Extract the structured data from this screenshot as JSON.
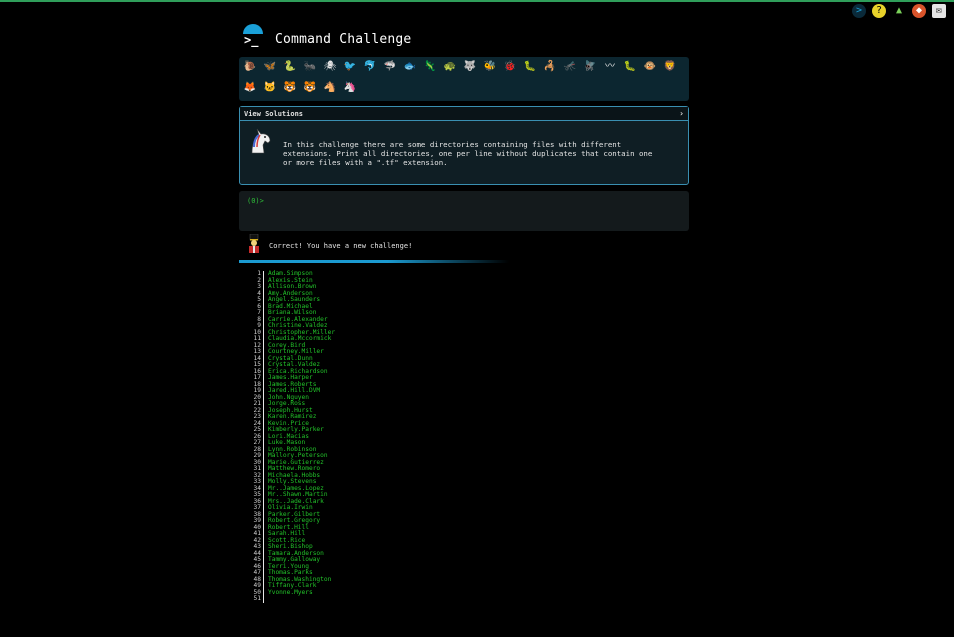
{
  "app": {
    "title": "Command Challenge",
    "prompt_glyph": ">_"
  },
  "top_icons": [
    "command-icon",
    "help-icon",
    "tree-icon",
    "fox-icon",
    "mail-icon"
  ],
  "badges": [
    [
      "snail",
      "🐌"
    ],
    [
      "butterfly",
      "🦋"
    ],
    [
      "snake",
      "🐍"
    ],
    [
      "ant",
      "🐜"
    ],
    [
      "spider",
      "🕷"
    ],
    [
      "bird",
      "🐦"
    ],
    [
      "dolphin",
      "🐬"
    ],
    [
      "shark",
      "🦈"
    ],
    [
      "fish",
      "🐟"
    ],
    [
      "lizard",
      "🦎"
    ],
    [
      "turtle",
      "🐢"
    ],
    [
      "wolf",
      "🐺"
    ],
    [
      "bee",
      "🐝"
    ],
    [
      "ladybug",
      "🐞"
    ],
    [
      "worm",
      "🐛"
    ],
    [
      "scorpion",
      "🦂"
    ],
    [
      "mosquito",
      "🦟"
    ],
    [
      "fly",
      "🪰"
    ],
    [
      "eel",
      "〰"
    ],
    [
      "caterpillar",
      "🐛"
    ],
    [
      "monkey",
      "🐵"
    ],
    [
      "lion",
      "🦁"
    ],
    [
      "fox",
      "🦊"
    ],
    [
      "cat",
      "🐱"
    ],
    [
      "tiger",
      "🐯"
    ],
    [
      "tiger2",
      "🐯"
    ],
    [
      "horse",
      "🐴"
    ],
    [
      "unicorn",
      "🦄"
    ]
  ],
  "solutions": {
    "header": "View Solutions",
    "chevron": "›",
    "description": "In this challenge there are some directories containing files with different\nextensions. Print all directories, one per line without duplicates that contain one\nor more files with a \".tf\" extension."
  },
  "terminal": {
    "prompt": "(0)>"
  },
  "status": {
    "message": "Correct! You have a new challenge!"
  },
  "output": {
    "lines": [
      "Adam.Simpson",
      "Alexis.Stein",
      "Allison.Brown",
      "Amy.Anderson",
      "Angel.Saunders",
      "Brad.Michael",
      "Briana.Wilson",
      "Carrie.Alexander",
      "Christine.Valdez",
      "Christopher.Miller",
      "Claudia.Mccormick",
      "Corey.Bird",
      "Courtney.Miller",
      "Crystal.Dunn",
      "Crystal.Valdez",
      "Erica.Richardson",
      "James.Harper",
      "James.Roberts",
      "Jared.Hill.DVM",
      "John.Nguyen",
      "Jorge.Ross",
      "Joseph.Hurst",
      "Karen.Ramirez",
      "Kevin.Price",
      "Kimberly.Parker",
      "Lori.Macias",
      "Luke.Mason",
      "Lynn.Robinson",
      "Mallory.Peterson",
      "Marie.Gutierrez",
      "Matthew.Romero",
      "Michaela.Hobbs",
      "Molly.Stevens",
      "Mr..James.Lopez",
      "Mr..Shawn.Martin",
      "Mrs..Jade.Clark",
      "Olivia.Irwin",
      "Parker.Gilbert",
      "Robert.Gregory",
      "Robert.Hill",
      "Sarah.Hill",
      "Scott.Rice",
      "Sheri.Bishop",
      "Tamara.Anderson",
      "Tammy.Galloway",
      "Terri.Young",
      "Thomas.Parks",
      "Thomas.Washington",
      "Tiffany.Clark",
      "Yvonne.Myers",
      ""
    ]
  }
}
